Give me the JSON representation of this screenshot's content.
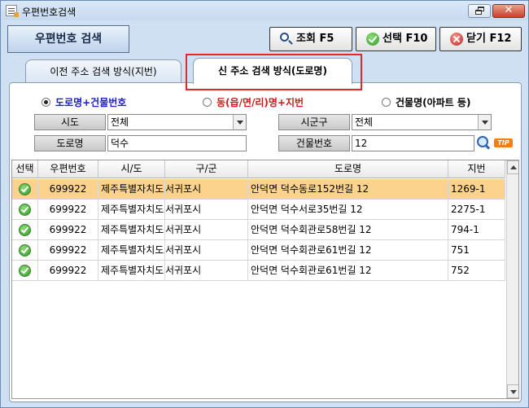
{
  "window": {
    "title": "우편번호검색"
  },
  "header": {
    "heading": "우편번호 검색"
  },
  "toolbar": {
    "search_label": "조회 F5",
    "select_label": "선택 F10",
    "close_label": "닫기 F12"
  },
  "tabs": [
    {
      "label": "이전 주소 검색 방식(지번)"
    },
    {
      "label": "신 주소 검색 방식(도로명)"
    }
  ],
  "search": {
    "options": [
      {
        "label": "도로명+건물번호",
        "selected": true
      },
      {
        "label": "동(읍/면/리)명+지번",
        "selected": false
      },
      {
        "label": "건물명(아파트 등)",
        "selected": false
      }
    ],
    "sido_label": "시도",
    "sido_value": "전체",
    "sigungu_label": "시군구",
    "sigungu_value": "전체",
    "road_label": "도로명",
    "road_value": "덕수",
    "building_no_label": "건물번호",
    "building_no_value": "12",
    "tip_label": "TIP"
  },
  "grid": {
    "columns": [
      "선택",
      "우편번호",
      "시/도",
      "구/군",
      "도로명",
      "지번"
    ],
    "rows": [
      {
        "zip": "699922",
        "sido": "제주특별자치도",
        "gugun": "서귀포시",
        "road": "안덕면 덕수동로152번길 12",
        "jibun": "1269-1"
      },
      {
        "zip": "699922",
        "sido": "제주특별자치도",
        "gugun": "서귀포시",
        "road": "안덕면 덕수서로35번길 12",
        "jibun": "2275-1"
      },
      {
        "zip": "699922",
        "sido": "제주특별자치도",
        "gugun": "서귀포시",
        "road": "안덕면 덕수회관로58번길 12",
        "jibun": "794-1"
      },
      {
        "zip": "699922",
        "sido": "제주특별자치도",
        "gugun": "서귀포시",
        "road": "안덕면 덕수회관로61번길 12",
        "jibun": "751"
      },
      {
        "zip": "699922",
        "sido": "제주특별자치도",
        "gugun": "서귀포시",
        "road": "안덕면 덕수회관로61번길 12",
        "jibun": "752"
      }
    ]
  },
  "colors": {
    "highlight_row": "#fbd38c",
    "active_tab_outline": "#e02a2a",
    "accent_blue": "#1c1cc8",
    "accent_red": "#d01818"
  }
}
